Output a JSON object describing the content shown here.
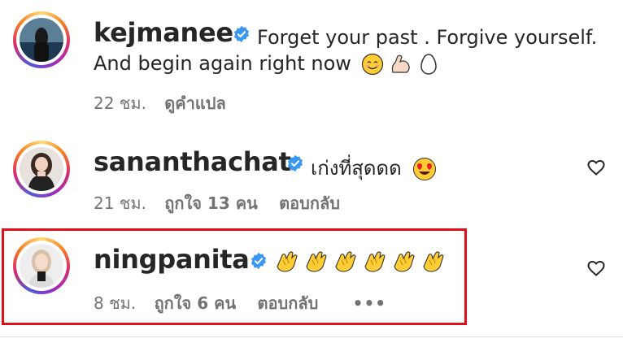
{
  "comments": [
    {
      "username": "kejmanee",
      "text_line1": "Forget your past . Forgive yourself.",
      "text_line2": "And begin again right now",
      "time": "22 ชม.",
      "translate": "ดูคำแปล",
      "emojis": [
        "smiling-face-emoji",
        "flexed-biceps-emoji",
        "egg-emoji"
      ]
    },
    {
      "username": "sananthachat",
      "text": "เก่งที่สุดดด",
      "time": "21 ชม.",
      "likes": "ถูกใจ 13 คน",
      "reply": "ตอบกลับ",
      "emojis": [
        "heart-eyes-emoji"
      ]
    },
    {
      "username": "ningpanita",
      "time": "8 ชม.",
      "likes": "ถูกใจ 6 คน",
      "reply": "ตอบกลับ",
      "more": "•••",
      "emojis": [
        "clapping-hands-emoji",
        "clapping-hands-emoji",
        "clapping-hands-emoji",
        "clapping-hands-emoji",
        "clapping-hands-emoji",
        "clapping-hands-emoji"
      ]
    }
  ],
  "colors": {
    "verified": "#3897f0",
    "meta": "#737373",
    "highlight": "#e0101a"
  }
}
